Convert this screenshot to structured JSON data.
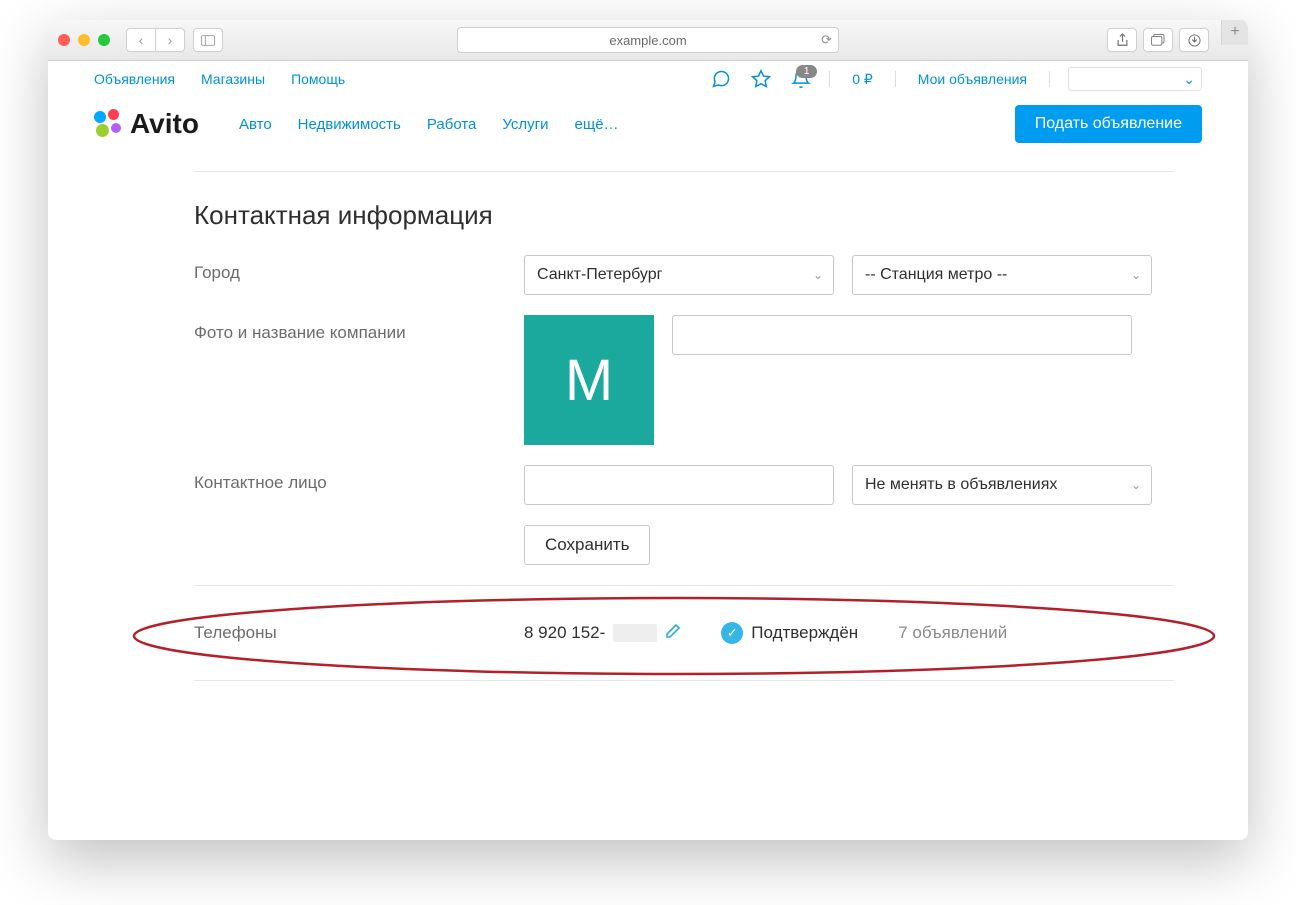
{
  "browser": {
    "url": "example.com"
  },
  "topbar": {
    "links": [
      "Объявления",
      "Магазины",
      "Помощь"
    ],
    "notif_badge": "1",
    "balance": "0 ₽",
    "my_ads": "Мои объявления"
  },
  "logo_text": "Avito",
  "main_nav": [
    "Авто",
    "Недвижимость",
    "Работа",
    "Услуги",
    "ещё…"
  ],
  "cta": "Подать объявление",
  "section_title": "Контактная информация",
  "labels": {
    "city": "Город",
    "company": "Фото и название компании",
    "contact": "Контактное лицо",
    "phones": "Телефоны"
  },
  "city_select": "Санкт-Петербург",
  "metro_select": "-- Станция метро --",
  "avatar_letter": "М",
  "ads_update_select": "Не менять в объявлениях",
  "save_button": "Сохранить",
  "phone_number": "8 920 152-",
  "phone_confirmed": "Подтверждён",
  "phone_ads_count": "7 объявлений"
}
